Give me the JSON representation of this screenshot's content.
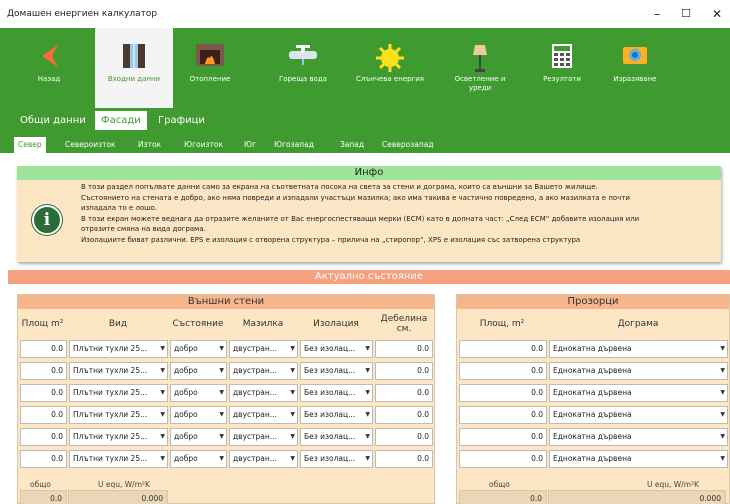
{
  "window": {
    "title": "Домашен енергиен калкулатор",
    "minimize": "–",
    "maximize": "☐",
    "close": "✕"
  },
  "nav": [
    {
      "label": "Назад",
      "icon": "back-arrow-icon"
    },
    {
      "label": "Входни данни",
      "icon": "window-icon"
    },
    {
      "label": "Отопление",
      "icon": "fireplace-icon"
    },
    {
      "label": "Гореща вода",
      "icon": "faucet-icon"
    },
    {
      "label": "Слънчева енергия",
      "icon": "sun-icon"
    },
    {
      "label": "Осветление и уреди",
      "icon": "lamp-icon"
    },
    {
      "label": "Резултати",
      "icon": "calculator-icon"
    },
    {
      "label": "Изразяване",
      "icon": "camera-icon"
    }
  ],
  "tabs": [
    "Общи данни",
    "Фасади",
    "Графици"
  ],
  "directions": [
    "Север",
    "Североизток",
    "Изток",
    "Югоизток",
    "Юг",
    "Югозапад",
    "Запад",
    "Северозапад"
  ],
  "info": {
    "title": "Инфо",
    "line1": "В този раздел попълвате данни само за екрана на съответната посока на света за стени и дограма, които са външни за Вашето жилище.",
    "line2": "Състоянието на стената е добро, ако няма повреди и изпадали участъци мазилка; ако има такива е частично повредено, а ако мазилката е почти",
    "line3": "изпадала то е лошо.",
    "line4": "В този екран можете веднага да отразите желаните от Вас енергоспестяващи мерки (ЕСМ) като в долната част: „След ЕСМ“ добавите изолация или",
    "line5": "отразите смяна на вида дограма.",
    "line6": "Изолациите биват различни. EPS е изолация с отворена структура – прилича на „стиропор“, XPS е изолация със затворена структура"
  },
  "state_title": "Актуално състояние",
  "walls": {
    "title": "Външни стени",
    "col_area": "Площ m²",
    "col_type": "Вид",
    "col_state": "Състояние",
    "col_plaster": "Мазилка",
    "col_insulation": "Изолация",
    "col_thickness": "Дебелина см.",
    "rows": [
      {
        "area": "0.0",
        "type": "Плътни тухли 25...",
        "state": "добро",
        "plaster": "двустран...",
        "insulation": "Без изолац...",
        "thickness": "0.0"
      },
      {
        "area": "0.0",
        "type": "Плътни тухли 25...",
        "state": "добро",
        "plaster": "двустран...",
        "insulation": "Без изолац...",
        "thickness": "0.0"
      },
      {
        "area": "0.0",
        "type": "Плътни тухли 25...",
        "state": "добро",
        "plaster": "двустран...",
        "insulation": "Без изолац...",
        "thickness": "0.0"
      },
      {
        "area": "0.0",
        "type": "Плътни тухли 25...",
        "state": "добро",
        "plaster": "двустран...",
        "insulation": "Без изолац...",
        "thickness": "0.0"
      },
      {
        "area": "0.0",
        "type": "Плътни тухли 25...",
        "state": "добро",
        "plaster": "двустран...",
        "insulation": "Без изолац...",
        "thickness": "0.0"
      },
      {
        "area": "0.0",
        "type": "Плътни тухли 25...",
        "state": "добро",
        "plaster": "двустран...",
        "insulation": "Без изолац...",
        "thickness": "0.0"
      }
    ],
    "total_label": "общо",
    "uequ_label": "U equ, W/m²K",
    "total_value": "0.0",
    "uequ_value": "0.000"
  },
  "windows": {
    "title": "Прозорци",
    "col_area": "Площ, m²",
    "col_frame": "Дограма",
    "rows": [
      {
        "area": "0.0",
        "frame": "Еднокатна дървена"
      },
      {
        "area": "0.0",
        "frame": "Еднокатна дървена"
      },
      {
        "area": "0.0",
        "frame": "Еднокатна дървена"
      },
      {
        "area": "0.0",
        "frame": "Еднокатна дървена"
      },
      {
        "area": "0.0",
        "frame": "Еднокатна дървена"
      },
      {
        "area": "0.0",
        "frame": "Еднокатна дървена"
      }
    ],
    "total_label": "общо",
    "uequ_label": "U equ, W/m²K",
    "total_value": "0.0",
    "uequ_value": "0.000"
  },
  "colors": {
    "green": "#3f9a2f",
    "info_head": "#9ee39a",
    "orange": "#f5a07e",
    "panel": "#fde6c3"
  }
}
